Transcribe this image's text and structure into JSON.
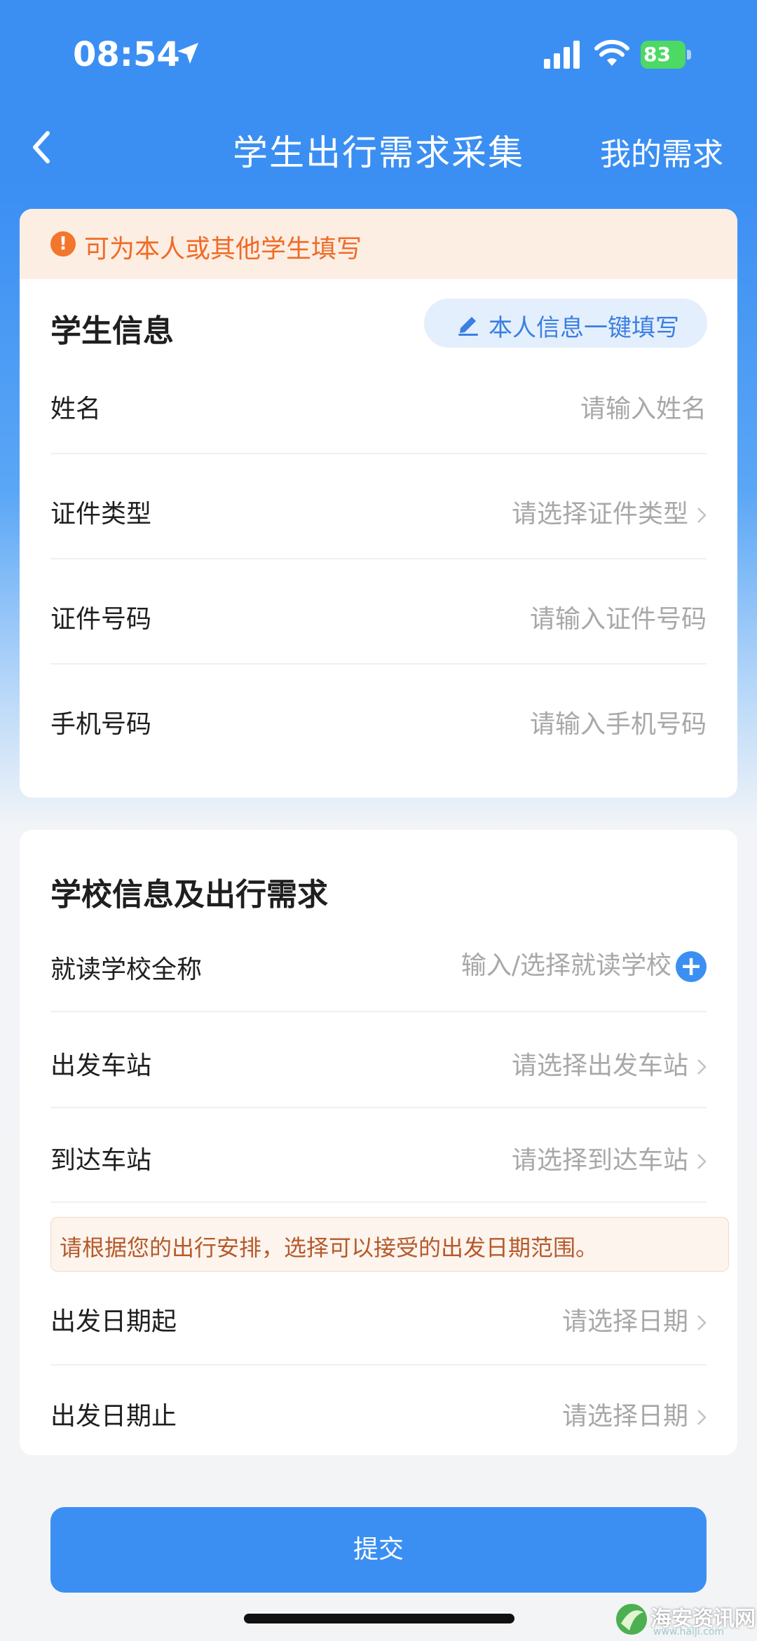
{
  "status_bar": {
    "time": "08:54",
    "battery": "83"
  },
  "nav": {
    "title": "学生出行需求采集",
    "right_label": "我的需求"
  },
  "student_card": {
    "notice": "可为本人或其他学生填写",
    "section_title": "学生信息",
    "quick_fill_label": "本人信息一键填写",
    "fields": [
      {
        "label": "姓名",
        "placeholder": "请输入姓名"
      },
      {
        "label": "证件类型",
        "placeholder": "请选择证件类型"
      },
      {
        "label": "证件号码",
        "placeholder": "请输入证件号码"
      },
      {
        "label": "手机号码",
        "placeholder": "请输入手机号码"
      }
    ]
  },
  "school_card": {
    "section_title": "学校信息及出行需求",
    "fields": [
      {
        "label": "就读学校全称",
        "placeholder": "输入/选择就读学校"
      },
      {
        "label": "出发车站",
        "placeholder": "请选择出发车站"
      },
      {
        "label": "到达车站",
        "placeholder": "请选择到达车站"
      }
    ],
    "date_tip": "请根据您的出行安排，选择可以接受的出发日期范围。",
    "date_fields": [
      {
        "label": "出发日期起",
        "placeholder": "请选择日期"
      },
      {
        "label": "出发日期止",
        "placeholder": "请选择日期"
      }
    ]
  },
  "submit_label": "提交",
  "watermark": {
    "text": "海安资讯网",
    "sub": "www.haiji.com"
  },
  "colors": {
    "primary": "#3b8ff3",
    "notice_orange": "#f06b26",
    "battery_green": "#4cd964"
  }
}
